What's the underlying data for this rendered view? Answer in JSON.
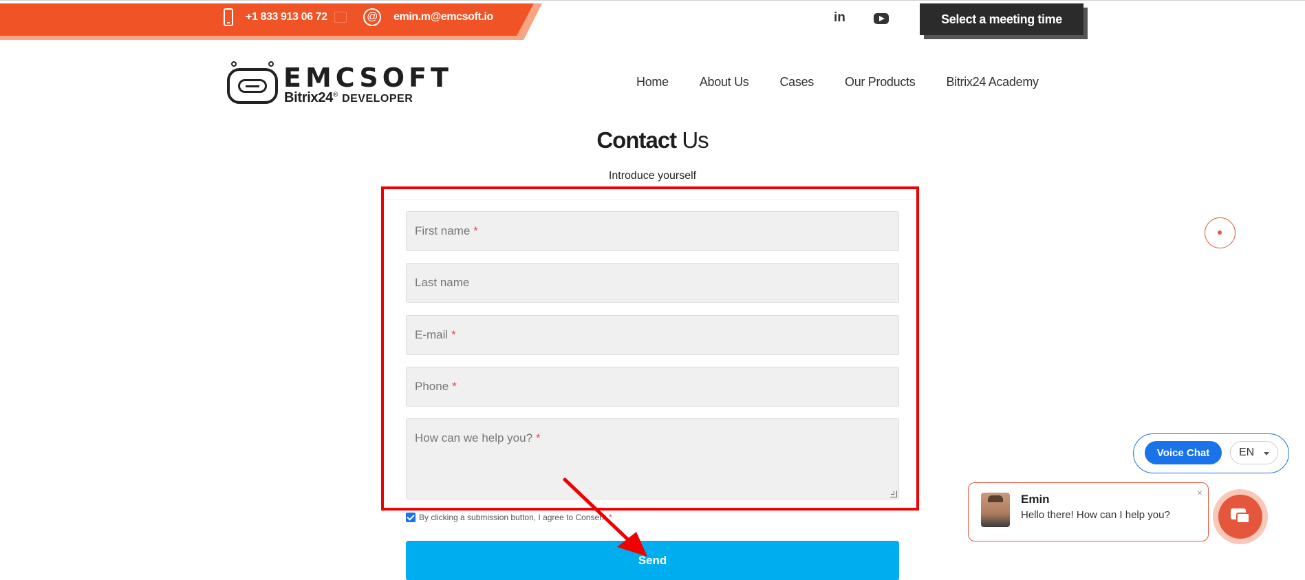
{
  "topbar": {
    "phone": "+1 833 913 06 72",
    "email": "emin.m@emcsoft.io"
  },
  "header": {
    "meeting_label": "Select a meeting time",
    "linkedin_label": "in",
    "logo": {
      "name": "EMCSOFT",
      "sub_brand": "Bitrix24",
      "sub_mark": "®",
      "sub_tag": "DEVELOPER"
    },
    "nav": [
      "Home",
      "About Us",
      "Cases",
      "Our Products",
      "Bitrix24 Academy"
    ]
  },
  "page": {
    "title_bold": "Contact",
    "title_rest": " Us",
    "intro": "Introduce yourself"
  },
  "form": {
    "first_name": {
      "placeholder": "First name",
      "required": "*"
    },
    "last_name": {
      "placeholder": "Last name"
    },
    "email": {
      "placeholder": "E-mail",
      "required": "*"
    },
    "phone": {
      "placeholder": "Phone",
      "required": "*"
    },
    "message": {
      "placeholder": "How can we help you?",
      "required": "*"
    },
    "agree_text": "By clicking a submission button, I agree to Consent",
    "agree_required": "*",
    "agree_checked": true,
    "send_label": "Send"
  },
  "widgets": {
    "voice_chat_label": "Voice Chat",
    "language": "EN",
    "chat_name": "Emin",
    "chat_message": "Hello there! How can I help you?",
    "chat_close": "×"
  },
  "colors": {
    "brand_orange": "#f05426",
    "send_blue": "#00aeef",
    "voice_blue": "#1a73e8",
    "annotation_red": "#f00000"
  }
}
